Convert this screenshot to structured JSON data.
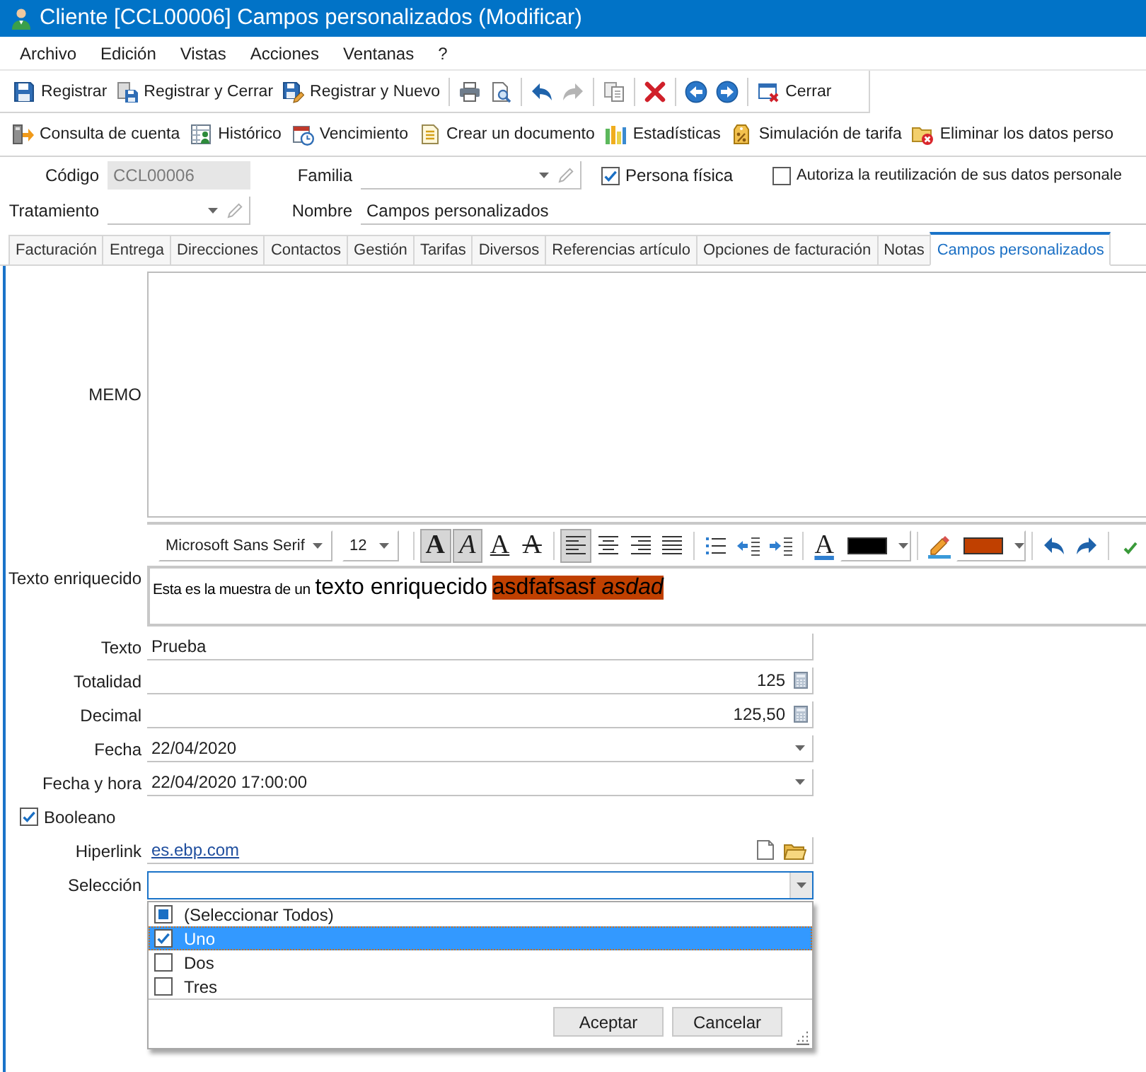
{
  "window": {
    "title": "Cliente [CCL00006] Campos personalizados (Modificar)"
  },
  "menu": [
    "Archivo",
    "Edición",
    "Vistas",
    "Acciones",
    "Ventanas",
    "?"
  ],
  "toolbar": {
    "groups": [
      [
        {
          "label": "Registrar",
          "disabled": false
        },
        {
          "label": "Registrar y Cerrar",
          "disabled": false
        },
        {
          "label": "Registrar y Nuevo",
          "disabled": false
        }
      ],
      [
        {
          "disabled": false
        },
        {
          "disabled": false
        }
      ],
      [
        {
          "disabled": false
        },
        {
          "disabled": true
        }
      ],
      [
        {
          "disabled": false
        }
      ],
      [
        {
          "disabled": false
        }
      ],
      [
        {
          "disabled": false
        },
        {
          "disabled": false
        }
      ],
      [
        {
          "label": "Cerrar",
          "disabled": false
        }
      ]
    ]
  },
  "actions": [
    "Consulta de cuenta",
    "Histórico",
    "Vencimiento",
    "Crear un documento",
    "Estadísticas",
    "Simulación de tarifa",
    "Eliminar los datos perso"
  ],
  "header": {
    "code": {
      "label": "Código",
      "value": "CCL00006",
      "disabled": true
    },
    "family": {
      "label": "Familia"
    },
    "natural_person": {
      "label": "Persona física",
      "checked": true
    },
    "consent": {
      "label": "Autoriza la reutilización de sus datos personale",
      "checked": false
    },
    "treatment": {
      "label": "Tratamiento"
    },
    "name": {
      "label": "Nombre",
      "value": "Campos personalizados"
    }
  },
  "tabs": [
    {
      "label": "Facturación",
      "selected": false
    },
    {
      "label": "Entrega",
      "selected": false
    },
    {
      "label": "Direcciones",
      "selected": false
    },
    {
      "label": "Contactos",
      "selected": false
    },
    {
      "label": "Gestión",
      "selected": false
    },
    {
      "label": "Tarifas",
      "selected": false
    },
    {
      "label": "Diversos",
      "selected": false
    },
    {
      "label": "Referencias artículo",
      "selected": false
    },
    {
      "label": "Opciones de facturación",
      "selected": false
    },
    {
      "label": "Notas",
      "selected": false
    },
    {
      "label": "Campos personalizados",
      "selected": true
    }
  ],
  "custom_fields": [
    {
      "kind": "memo",
      "label": "MEMO"
    },
    {
      "kind": "richtext",
      "label": "Texto enriquecido",
      "toolbar": {
        "groups": [
          [
            {
              "kind": "combo",
              "value": "Microsoft Sans Serif"
            },
            {
              "kind": "combo",
              "value": "12"
            }
          ],
          [
            {
              "kind": "toggle",
              "label": "A",
              "pressed": true
            },
            {
              "kind": "toggle",
              "label": "A",
              "pressed": true
            },
            {
              "kind": "toggle",
              "label": "A",
              "pressed": false
            },
            {
              "kind": "toggle",
              "label": "A",
              "pressed": false
            }
          ],
          [
            {
              "kind": "toggle",
              "pressed": true
            },
            {
              "kind": "toggle",
              "pressed": false
            },
            {
              "kind": "toggle",
              "pressed": false
            },
            {
              "kind": "toggle",
              "pressed": false
            }
          ],
          [
            {
              "kind": "toggle",
              "pressed": false
            },
            {
              "kind": "toggle",
              "pressed": false
            },
            {
              "kind": "toggle",
              "pressed": false
            }
          ],
          [
            {
              "kind": "button",
              "label": "A"
            },
            {
              "kind": "color",
              "color": "#000000"
            }
          ],
          [
            {
              "kind": "button"
            },
            {
              "kind": "color",
              "color": "#c04000"
            }
          ],
          [
            {
              "kind": "button"
            },
            {
              "kind": "button"
            }
          ],
          [
            {
              "kind": "button"
            }
          ]
        ]
      },
      "content": [
        {
          "kind": "plain",
          "text": "Esta es la muestra de un"
        },
        {
          "kind": "large",
          "text": "texto enriquecido"
        },
        {
          "kind": "highlighted",
          "text": "asdfafsasf *asdad*"
        }
      ]
    },
    {
      "kind": "text",
      "label": "Texto",
      "value": "Prueba"
    },
    {
      "kind": "number",
      "label": "Totalidad",
      "value": "125"
    },
    {
      "kind": "number",
      "label": "Decimal",
      "value": "125,50"
    },
    {
      "kind": "date",
      "label": "Fecha",
      "value": "22/04/2020"
    },
    {
      "kind": "date",
      "label": "Fecha y hora",
      "value": "22/04/2020 17:00:00"
    },
    {
      "kind": "checkbox",
      "label": "Booleano",
      "checked": true
    },
    {
      "kind": "link",
      "label": "Hiperlink",
      "value": "es.ebp.com"
    },
    {
      "kind": "select",
      "label": "Selección",
      "focused": true,
      "dropdown": {
        "options": [
          {
            "label": "(Seleccionar Todos)",
            "checked": false,
            "indeterminate": true,
            "selected": false
          },
          {
            "label": "Uno",
            "checked": true,
            "indeterminate": false,
            "selected": true
          },
          {
            "label": "Dos",
            "checked": false,
            "indeterminate": false,
            "selected": false
          },
          {
            "label": "Tres",
            "checked": false,
            "indeterminate": false,
            "selected": false
          }
        ],
        "buttons": [
          "Aceptar",
          "Cancelar"
        ]
      }
    }
  ]
}
